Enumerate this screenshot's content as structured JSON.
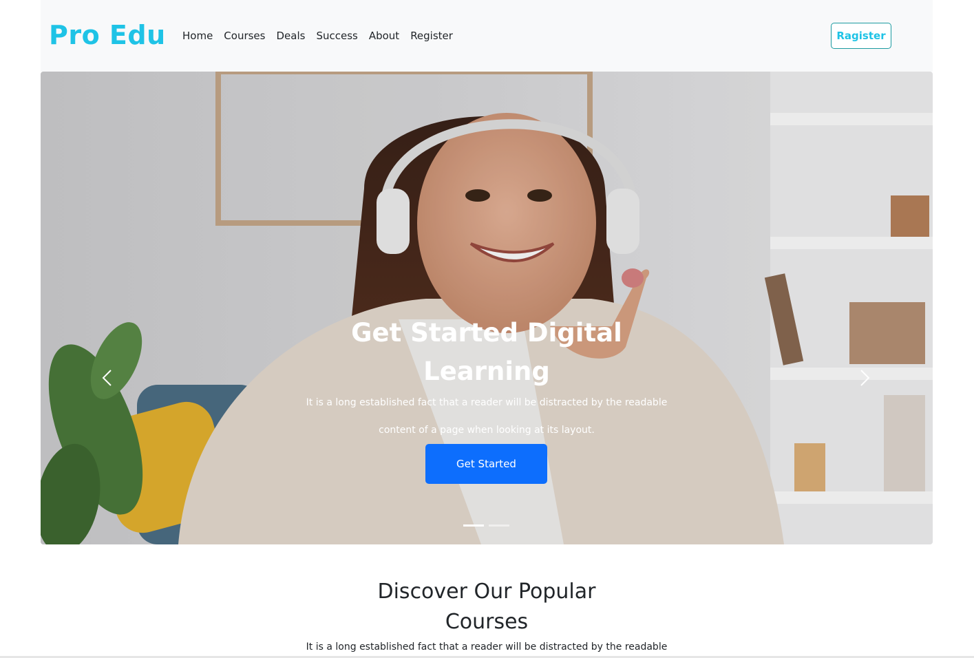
{
  "navbar": {
    "brand": "Pro Edu",
    "links": [
      "Home",
      "Courses",
      "Deals",
      "Success",
      "About",
      "Register"
    ],
    "register_button": "Ragister",
    "brand_color": "#1fc3e6"
  },
  "hero": {
    "title": "Get Started Digital Learning",
    "text": "It is a long established fact that a reader will be distracted by the readable content of a page when looking at its layout.",
    "button": "Get Started",
    "button_color": "#0d6efd",
    "prev_icon": "chevron-left-icon",
    "next_icon": "chevron-right-icon",
    "slides": 2,
    "active_slide": 1
  },
  "section": {
    "title": "Discover Our Popular Courses",
    "text": "It is a long established fact that a reader will be distracted by the readable"
  }
}
